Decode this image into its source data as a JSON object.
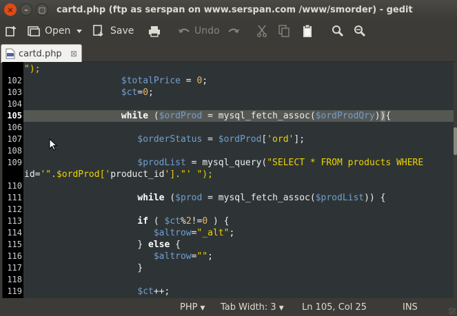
{
  "window": {
    "title": "cartd.php (ftp as serspan on www.serspan.com /www/smorder) - gedit",
    "controls": [
      "×",
      "–",
      "□"
    ]
  },
  "toolbar": {
    "open_label": "Open",
    "save_label": "Save",
    "undo_label": "Undo"
  },
  "tab": {
    "label": "cartd.php",
    "close": "⊠"
  },
  "editor": {
    "current_line": 105,
    "lines": [
      {
        "num": "",
        "text": "\");"
      },
      {
        "num": "102",
        "text": "                  $totalPrice = 0;"
      },
      {
        "num": "103",
        "text": "                  $ct=0;"
      },
      {
        "num": "104",
        "text": ""
      },
      {
        "num": "105",
        "text": "                  while ($ordProd = mysql_fetch_assoc($ordProdQry)){"
      },
      {
        "num": "106",
        "text": ""
      },
      {
        "num": "107",
        "text": "                     $orderStatus = $ordProd['ord'];"
      },
      {
        "num": "108",
        "text": ""
      },
      {
        "num": "109",
        "text": "                     $prodList = mysql_query(\"SELECT * FROM products WHERE"
      },
      {
        "num": "",
        "text": "id='\".$ordProd['product_id'].\"' \");"
      },
      {
        "num": "110",
        "text": ""
      },
      {
        "num": "111",
        "text": "                     while ($prod = mysql_fetch_assoc($prodList)) {"
      },
      {
        "num": "112",
        "text": ""
      },
      {
        "num": "113",
        "text": "                     if ( $ct%2!=0 ) {"
      },
      {
        "num": "114",
        "text": "                        $altrow=\"_alt\";"
      },
      {
        "num": "115",
        "text": "                     } else {"
      },
      {
        "num": "116",
        "text": "                        $altrow=\"\";"
      },
      {
        "num": "117",
        "text": "                     }"
      },
      {
        "num": "118",
        "text": ""
      },
      {
        "num": "119",
        "text": "                     $ct++;"
      }
    ]
  },
  "statusbar": {
    "language": "PHP",
    "tab_width": "Tab Width:  3",
    "position": "Ln 105, Col 25",
    "mode": "INS"
  },
  "colors": {
    "variable": "#729fcf",
    "keyword": "#ffffff",
    "string": "#edd400",
    "number": "#e9b96e",
    "editor_bg": "#2e3436",
    "current_line_bg": "#555753"
  }
}
